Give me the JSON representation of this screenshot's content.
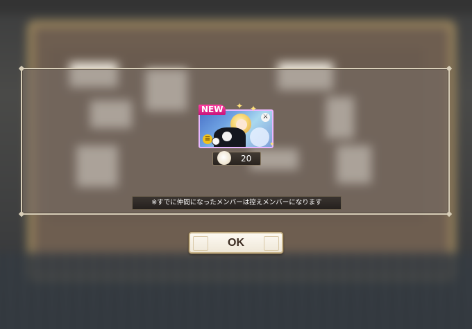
{
  "dialog": {
    "card": {
      "new_badge": "NEW",
      "class_icon": "class-coin-icon",
      "element_icon": "element-icon",
      "weapon_icon": "sword-icon",
      "colors": {
        "frame": "#e9b7ff",
        "badge": "#ff3fa0"
      }
    },
    "reward": {
      "icon": "character-fragment-icon",
      "count": "20"
    },
    "notice": "※すでに仲間になったメンバーは控えメンバーになります",
    "ok_label": "OK"
  }
}
